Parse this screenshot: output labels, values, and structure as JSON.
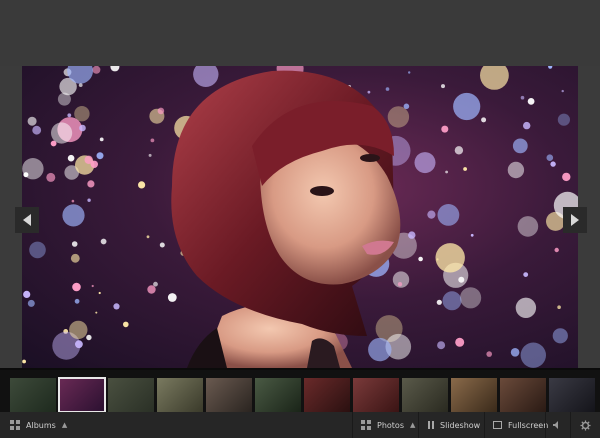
{
  "viewer": {
    "bottom_bar": {
      "albums_label": "Albums",
      "photos_label": "Photos",
      "slideshow_label": "Slideshow",
      "fullscreen_label": "Fullscreen"
    },
    "icons": {
      "prev": "chevron-left-icon",
      "next": "chevron-right-icon",
      "albums": "grid-icon",
      "photos": "grid-icon",
      "slideshow": "pause-icon",
      "fullscreen": "fullscreen-icon",
      "sound": "speaker-icon",
      "settings": "gear-icon"
    },
    "thumbnails": [
      {
        "colors": [
          "#3d4a3a",
          "#1e2a1e"
        ]
      },
      {
        "colors": [
          "#6a2a55",
          "#2a1030"
        ],
        "selected": true
      },
      {
        "colors": [
          "#4a5040",
          "#2a3026"
        ]
      },
      {
        "colors": [
          "#7a7a60",
          "#3a3a2a"
        ]
      },
      {
        "colors": [
          "#6a5a50",
          "#2a2420"
        ]
      },
      {
        "colors": [
          "#4a5a44",
          "#1a2418"
        ]
      },
      {
        "colors": [
          "#6a2a2a",
          "#2a1010"
        ]
      },
      {
        "colors": [
          "#7a3a3a",
          "#3a1414"
        ]
      },
      {
        "colors": [
          "#5a5a4a",
          "#2a2a20"
        ]
      },
      {
        "colors": [
          "#8a6a4a",
          "#3a2a1a"
        ]
      },
      {
        "colors": [
          "#6a4a3a",
          "#2a1a14"
        ]
      },
      {
        "colors": [
          "#3a3a44",
          "#14141a"
        ]
      }
    ]
  }
}
